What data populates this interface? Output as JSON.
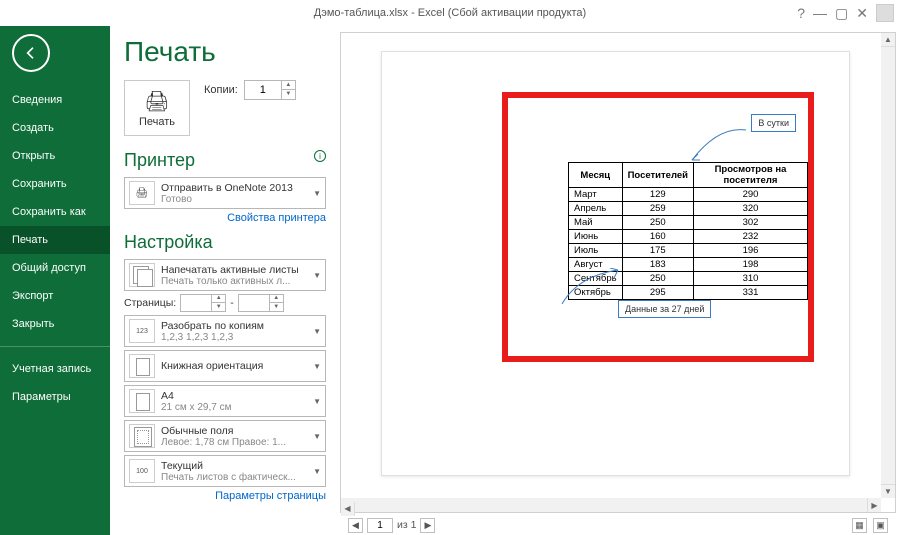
{
  "window": {
    "title": "Дэмо-таблица.xlsx - Excel (Сбой активации продукта)"
  },
  "sidebar": {
    "items": [
      "Сведения",
      "Создать",
      "Открыть",
      "Сохранить",
      "Сохранить как",
      "Печать",
      "Общий доступ",
      "Экспорт",
      "Закрыть"
    ],
    "active_index": 5,
    "account": "Учетная запись",
    "options": "Параметры"
  },
  "print": {
    "title": "Печать",
    "button": "Печать",
    "copies_label": "Копии:",
    "copies_value": "1"
  },
  "printer": {
    "heading": "Принтер",
    "name": "Отправить в OneNote 2013",
    "status": "Готово",
    "properties_link": "Свойства принтера"
  },
  "settings": {
    "heading": "Настройка",
    "active_sheets_l1": "Напечатать активные листы",
    "active_sheets_l2": "Печать только активных л...",
    "pages_label": "Страницы:",
    "pages_from": "",
    "pages_to": "",
    "collate_l1": "Разобрать по копиям",
    "collate_l2": "1,2,3   1,2,3   1,2,3",
    "orientation_l1": "Книжная ориентация",
    "paper_l1": "A4",
    "paper_l2": "21 см x 29,7 см",
    "margins_l1": "Обычные поля",
    "margins_l2": "Левое: 1,78 см  Правое: 1...",
    "scaling_l1": "Текущий",
    "scaling_l2": "Печать листов с фактическ...",
    "scaling_badge": "100",
    "page_setup_link": "Параметры страницы"
  },
  "preview": {
    "callout1": "В сутки",
    "callout2": "Данные за 27 дней",
    "page_current": "1",
    "page_of": "из 1"
  },
  "chart_data": {
    "type": "table",
    "columns": [
      "Месяц",
      "Посетителей",
      "Просмотров на посетителя"
    ],
    "rows": [
      [
        "Март",
        "129",
        "290"
      ],
      [
        "Апрель",
        "259",
        "320"
      ],
      [
        "Май",
        "250",
        "302"
      ],
      [
        "Июнь",
        "160",
        "232"
      ],
      [
        "Июль",
        "175",
        "196"
      ],
      [
        "Август",
        "183",
        "198"
      ],
      [
        "Сентябрь",
        "250",
        "310"
      ],
      [
        "Октябрь",
        "295",
        "331"
      ]
    ]
  }
}
